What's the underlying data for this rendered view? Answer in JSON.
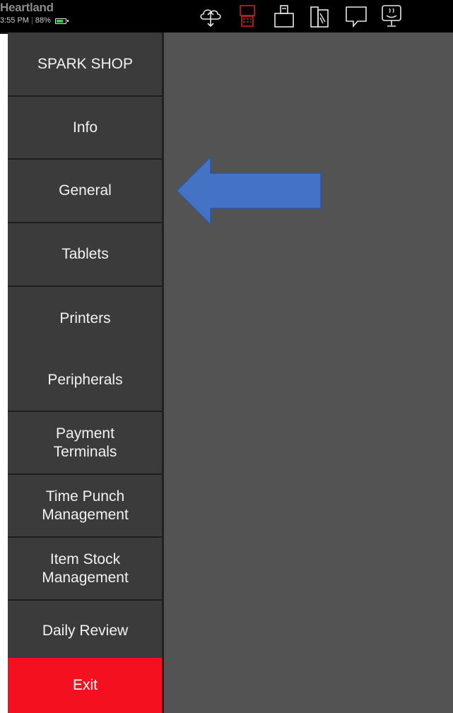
{
  "status_bar": {
    "brand": "Heartland",
    "time": "3:55 PM",
    "separator": "|",
    "battery_percent": "88%",
    "battery_level": 0.88,
    "icons": [
      "cloud-sync-icon",
      "terminal-alert-icon",
      "cash-drawer-icon",
      "card-reader-icon",
      "message-icon",
      "kitchen-display-icon"
    ],
    "alert_color": "#c8202a"
  },
  "sidebar": {
    "items": [
      {
        "label": "SPARK SHOP"
      },
      {
        "label": "Info"
      },
      {
        "label": "General"
      },
      {
        "label": "Tablets"
      },
      {
        "label": "Printers"
      },
      {
        "label": "Peripherals"
      },
      {
        "label": "Payment\nTerminals"
      },
      {
        "label": "Time Punch\nManagement"
      },
      {
        "label": "Item Stock\nManagement"
      },
      {
        "label": "Daily Review"
      },
      {
        "label": "Exit"
      }
    ]
  },
  "annotation": {
    "arrow_color": "#4472c4",
    "arrow_border_color": "#2f5597",
    "points_to": "General"
  },
  "colors": {
    "sidebar_bg": "#3b3b3b",
    "main_bg": "#535353",
    "exit_bg": "#f5101f"
  }
}
